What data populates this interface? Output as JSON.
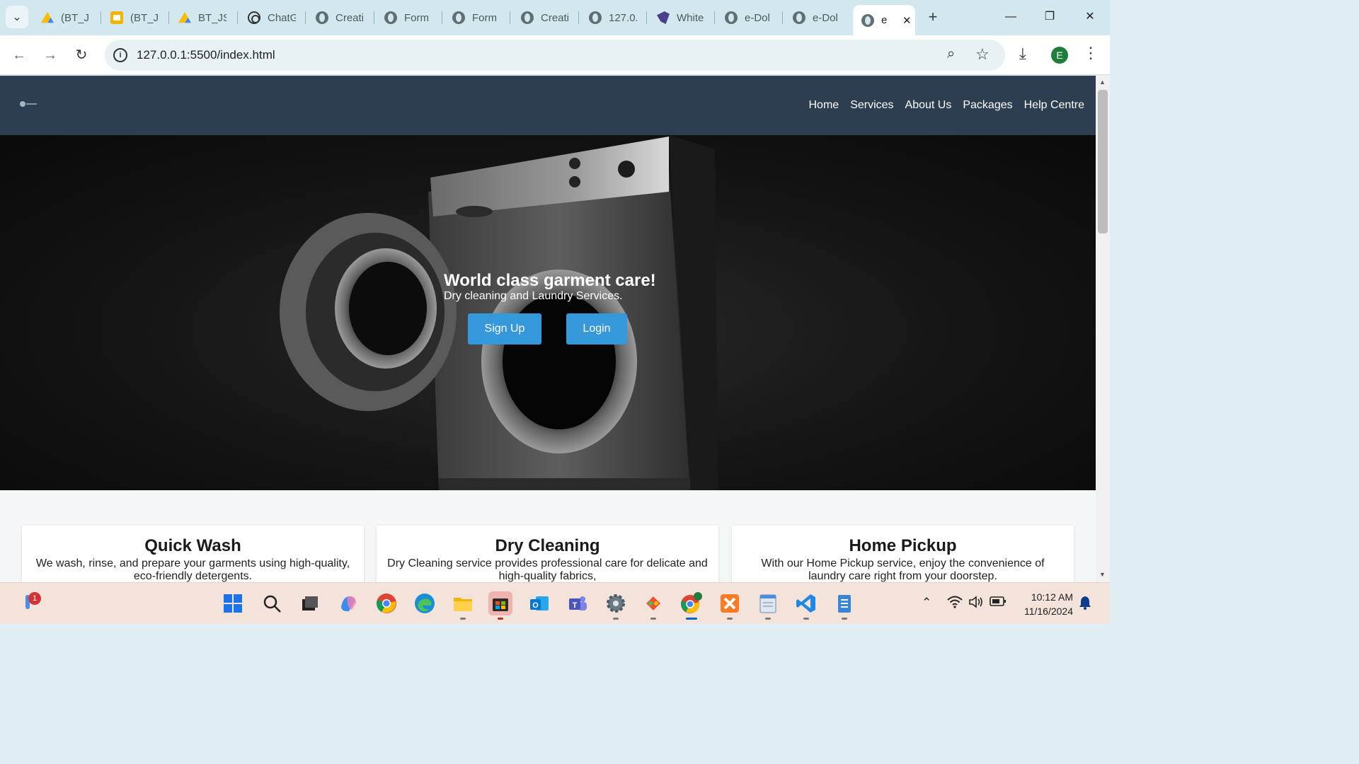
{
  "browser": {
    "tabs": [
      {
        "title": "(BT_JS",
        "icon": "google-drive-icon"
      },
      {
        "title": "(BT_JS",
        "icon": "google-slides-icon"
      },
      {
        "title": "BT_JSI",
        "icon": "google-drive-icon"
      },
      {
        "title": "ChatG",
        "icon": "chatgpt-icon"
      },
      {
        "title": "Creati",
        "icon": "globe-icon"
      },
      {
        "title": "Form",
        "icon": "globe-icon"
      },
      {
        "title": "Form",
        "icon": "globe-icon"
      },
      {
        "title": "Creati",
        "icon": "globe-icon"
      },
      {
        "title": "127.0.",
        "icon": "globe-icon"
      },
      {
        "title": "White",
        "icon": "whiteboard-icon"
      },
      {
        "title": "e-Dol",
        "icon": "globe-icon"
      },
      {
        "title": "e-Dol",
        "icon": "globe-icon"
      }
    ],
    "active_tab": {
      "title": "e",
      "icon": "globe-icon",
      "close": "✕"
    },
    "new_tab": "+",
    "window": {
      "minimize": "—",
      "restore": "❐",
      "close": "✕"
    },
    "url": "127.0.0.1:5500/index.html",
    "profile_initial": "E"
  },
  "site": {
    "nav": [
      "Home",
      "Services",
      "About Us",
      "Packages",
      "Help Centre"
    ],
    "hero": {
      "title": "World class garment care!",
      "subtitle": "Dry cleaning and Laundry Services.",
      "signup": "Sign Up",
      "login": "Login"
    },
    "services": [
      {
        "title": "Quick Wash",
        "desc": "We wash, rinse, and prepare your garments using high-quality, eco-friendly detergents."
      },
      {
        "title": "Dry Cleaning",
        "desc": "Dry Cleaning service provides professional care for delicate and high-quality fabrics,"
      },
      {
        "title": "Home Pickup",
        "desc": "With our Home Pickup service, enjoy the convenience of laundry care right from your doorstep."
      }
    ]
  },
  "taskbar": {
    "weather_badge": "1",
    "apps": [
      "windows-start-icon",
      "search-icon",
      "task-view-icon",
      "copilot-icon",
      "chrome-icon",
      "edge-icon",
      "file-explorer-icon",
      "microsoft-store-icon",
      "outlook-icon",
      "teams-icon",
      "settings-icon",
      "git-icon",
      "chrome-profile-icon",
      "xampp-icon",
      "notepad-icon",
      "vscode-icon",
      "notes-icon"
    ],
    "time": "10:12 AM",
    "date": "11/16/2024"
  },
  "colors": {
    "nav_bg": "#2c3e50",
    "button": "#3498db",
    "tabstrip": "#d3e7ee",
    "taskbar": "#f3e3da"
  }
}
